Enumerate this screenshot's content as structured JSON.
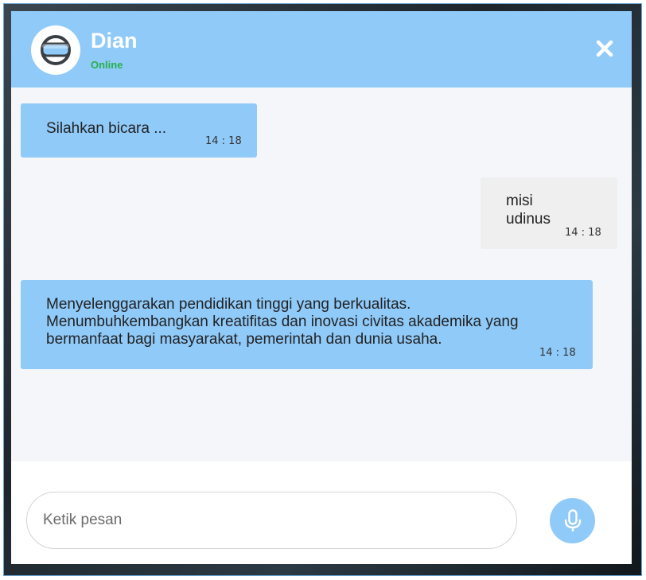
{
  "header": {
    "contact_name": "Dian",
    "status": "Online",
    "avatar_icon": "vr-headset-icon",
    "close_icon": "close-icon"
  },
  "messages": [
    {
      "direction": "incoming",
      "text": "Silahkan bicara ...",
      "time": "14 : 18"
    },
    {
      "direction": "outgoing",
      "text": "misi udinus",
      "time": "14 : 18"
    },
    {
      "direction": "incoming",
      "text": "Menyelenggarakan pendidikan tinggi yang berkualitas. Menumbuhkembangkan kreatifitas dan inovasi civitas akademika yang bermanfaat bagi masyarakat, pemerintah dan dunia usaha.",
      "time": "14 : 18"
    }
  ],
  "composer": {
    "placeholder": "Ketik pesan",
    "value": "",
    "mic_icon": "microphone-icon"
  },
  "colors": {
    "accent": "#90caf9",
    "status_online": "#27b04b",
    "outgoing_bubble": "#efefef",
    "panel_bg": "#f4f6f9"
  }
}
